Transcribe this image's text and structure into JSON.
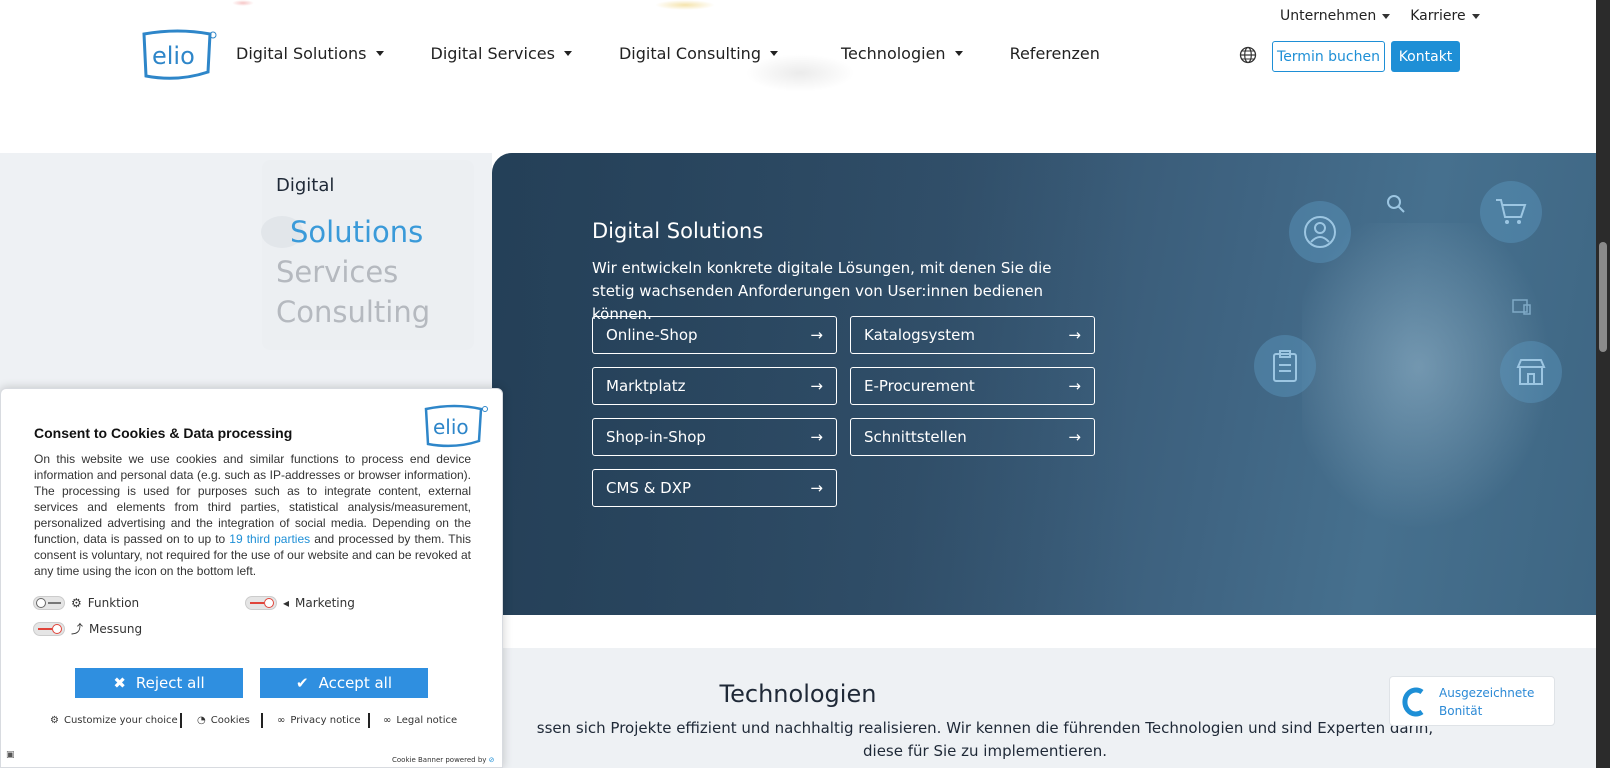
{
  "header": {
    "top_links": [
      "Unternehmen",
      "Karriere"
    ],
    "nav": [
      {
        "label": "Digital Solutions",
        "dropdown": true
      },
      {
        "label": "Digital Services",
        "dropdown": true
      },
      {
        "label": "Digital Consulting",
        "dropdown": true
      },
      {
        "label": "Technologien",
        "dropdown": true
      },
      {
        "label": "Referenzen",
        "dropdown": false
      }
    ],
    "termin_label": "Termin buchen",
    "kontakt_label": "Kontakt",
    "logo_text": "elio",
    "accent": "#1e8fd6"
  },
  "switcher": {
    "title": "Digital",
    "tabs": [
      "Solutions",
      "Services",
      "Consulting"
    ],
    "active_tab": "Solutions"
  },
  "hero": {
    "title": "Digital Solutions",
    "text": "Wir entwickeln konkrete digitale Lösungen, mit denen Sie die stetig wachsenden Anforderungen von User:innen bedienen können.",
    "buttons": [
      "Online-Shop",
      "Katalogsystem",
      "Marktplatz",
      "E-Procurement",
      "Shop-in-Shop",
      "Schnittstellen",
      "CMS & DXP"
    ],
    "arrow": "→"
  },
  "technologies": {
    "title": "Technologien",
    "text": "ssen sich Projekte effizient und nachhaltig realisieren. Wir kennen die führenden Technologien und sind Experten darin, diese für Sie zu implementieren."
  },
  "badge": {
    "line1": "Ausgezeichnete",
    "line2": "Bonität"
  },
  "cookie": {
    "title": "Consent to Cookies & Data processing",
    "body_pre": "On this website we use cookies and similar functions to process end device information and personal data (e.g. such as IP-addresses or browser information). The processing is used for purposes such as to integrate content, external services and elements from third parties, statistical analysis/measurement, personalized advertising and the integration of social media. Depending on the function, data is passed on to up to ",
    "body_link": "19 third parties",
    "body_post": " and processed by them. This consent is voluntary, not required for the use of our website and can be revoked at any time using the icon on the bottom left.",
    "toggles": [
      "Funktion",
      "Marketing",
      "Messung"
    ],
    "reject_label": "Reject all",
    "accept_label": "Accept all",
    "footer_links": [
      "Customize your choice",
      "Cookies",
      "Privacy notice",
      "Legal notice"
    ],
    "powered_by": "Cookie Banner powered by"
  }
}
